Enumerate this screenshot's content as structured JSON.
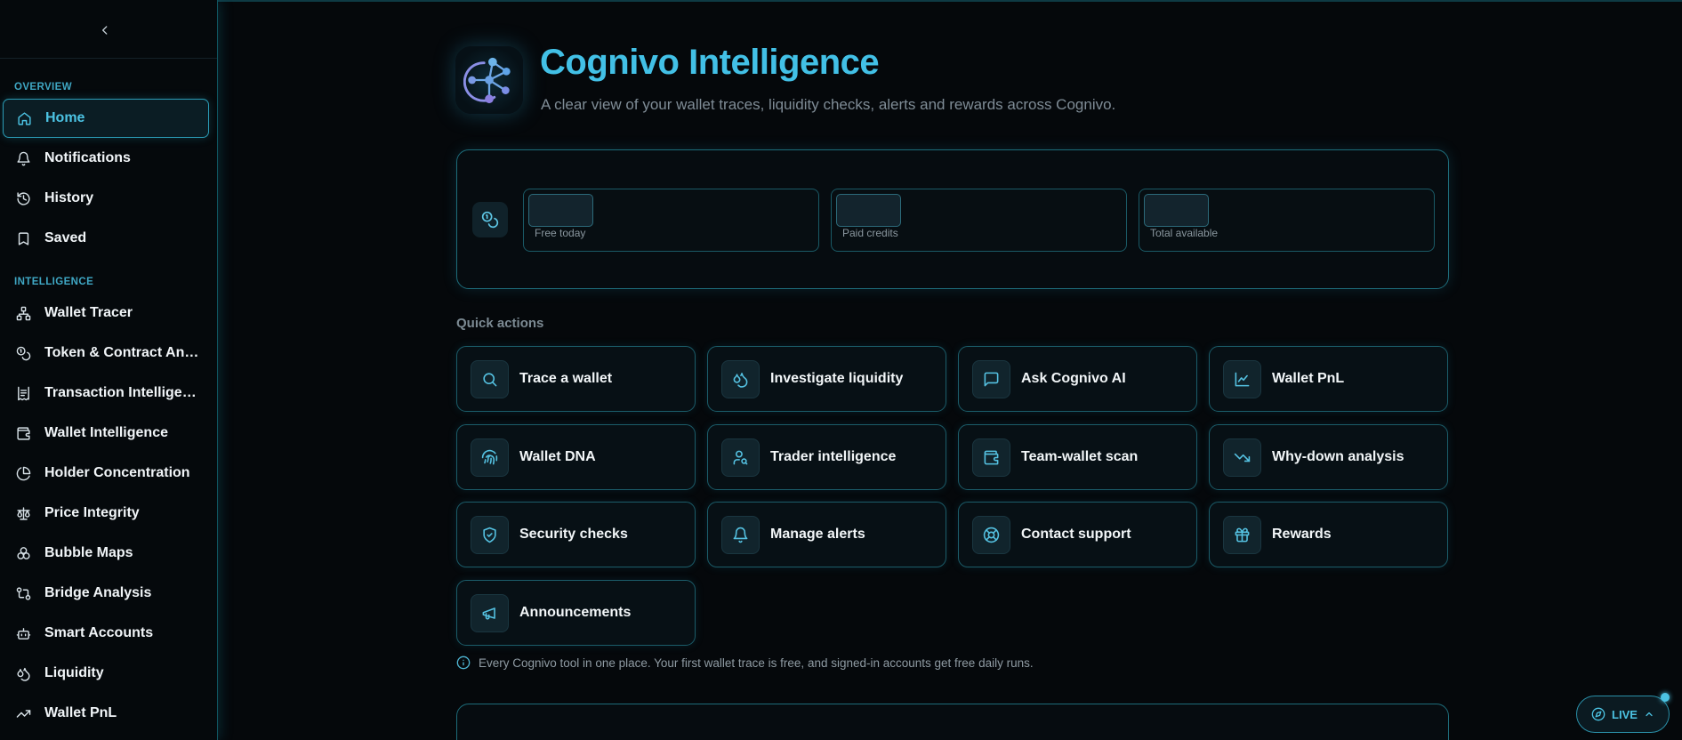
{
  "sidebar": {
    "sections": {
      "overview": "OVERVIEW",
      "intelligence": "INTELLIGENCE"
    },
    "items": [
      {
        "label": "Home",
        "icon": "home-icon"
      },
      {
        "label": "Notifications",
        "icon": "bell-icon"
      },
      {
        "label": "History",
        "icon": "history-icon"
      },
      {
        "label": "Saved",
        "icon": "bookmark-icon"
      },
      {
        "label": "Wallet Tracer",
        "icon": "network-icon"
      },
      {
        "label": "Token & Contract Anal...",
        "icon": "coins-icon"
      },
      {
        "label": "Transaction Intelligen...",
        "icon": "receipt-icon"
      },
      {
        "label": "Wallet Intelligence",
        "icon": "wallet-icon"
      },
      {
        "label": "Holder Concentration",
        "icon": "pie-chart-icon"
      },
      {
        "label": "Price Integrity",
        "icon": "scale-icon"
      },
      {
        "label": "Bubble Maps",
        "icon": "bubbles-icon"
      },
      {
        "label": "Bridge Analysis",
        "icon": "bridge-icon"
      },
      {
        "label": "Smart Accounts",
        "icon": "bot-icon"
      },
      {
        "label": "Liquidity",
        "icon": "droplets-icon"
      },
      {
        "label": "Wallet PnL",
        "icon": "trending-up-icon"
      }
    ]
  },
  "header": {
    "title": "Cognivo Intelligence",
    "subtitle": "A clear view of your wallet traces, liquidity checks, alerts and rewards across Cognivo."
  },
  "credits": [
    {
      "value": "",
      "label": "Free today"
    },
    {
      "value": "",
      "label": "Paid credits"
    },
    {
      "value": "",
      "label": "Total available"
    }
  ],
  "quick_actions": {
    "heading": "Quick actions",
    "items": [
      {
        "label": "Trace a wallet",
        "icon": "search-icon"
      },
      {
        "label": "Investigate liquidity",
        "icon": "droplets-icon"
      },
      {
        "label": "Ask Cognivo AI",
        "icon": "message-icon"
      },
      {
        "label": "Wallet PnL",
        "icon": "line-chart-icon"
      },
      {
        "label": "Wallet DNA",
        "icon": "fingerprint-icon"
      },
      {
        "label": "Trader intelligence",
        "icon": "user-search-icon"
      },
      {
        "label": "Team-wallet scan",
        "icon": "wallet-icon"
      },
      {
        "label": "Why-down analysis",
        "icon": "trending-down-icon"
      },
      {
        "label": "Security checks",
        "icon": "shield-check-icon"
      },
      {
        "label": "Manage alerts",
        "icon": "bell-icon"
      },
      {
        "label": "Contact support",
        "icon": "lifebuoy-icon"
      },
      {
        "label": "Rewards",
        "icon": "gift-icon"
      },
      {
        "label": "Announcements",
        "icon": "megaphone-icon"
      }
    ]
  },
  "info_text": "Every Cognivo tool in one place. Your first wallet trace is free, and signed-in accounts get free daily runs.",
  "live_button": {
    "label": "LIVE"
  },
  "colors": {
    "accent": "#42c0e6",
    "border": "#1d6c7a",
    "background": "#05080b"
  }
}
